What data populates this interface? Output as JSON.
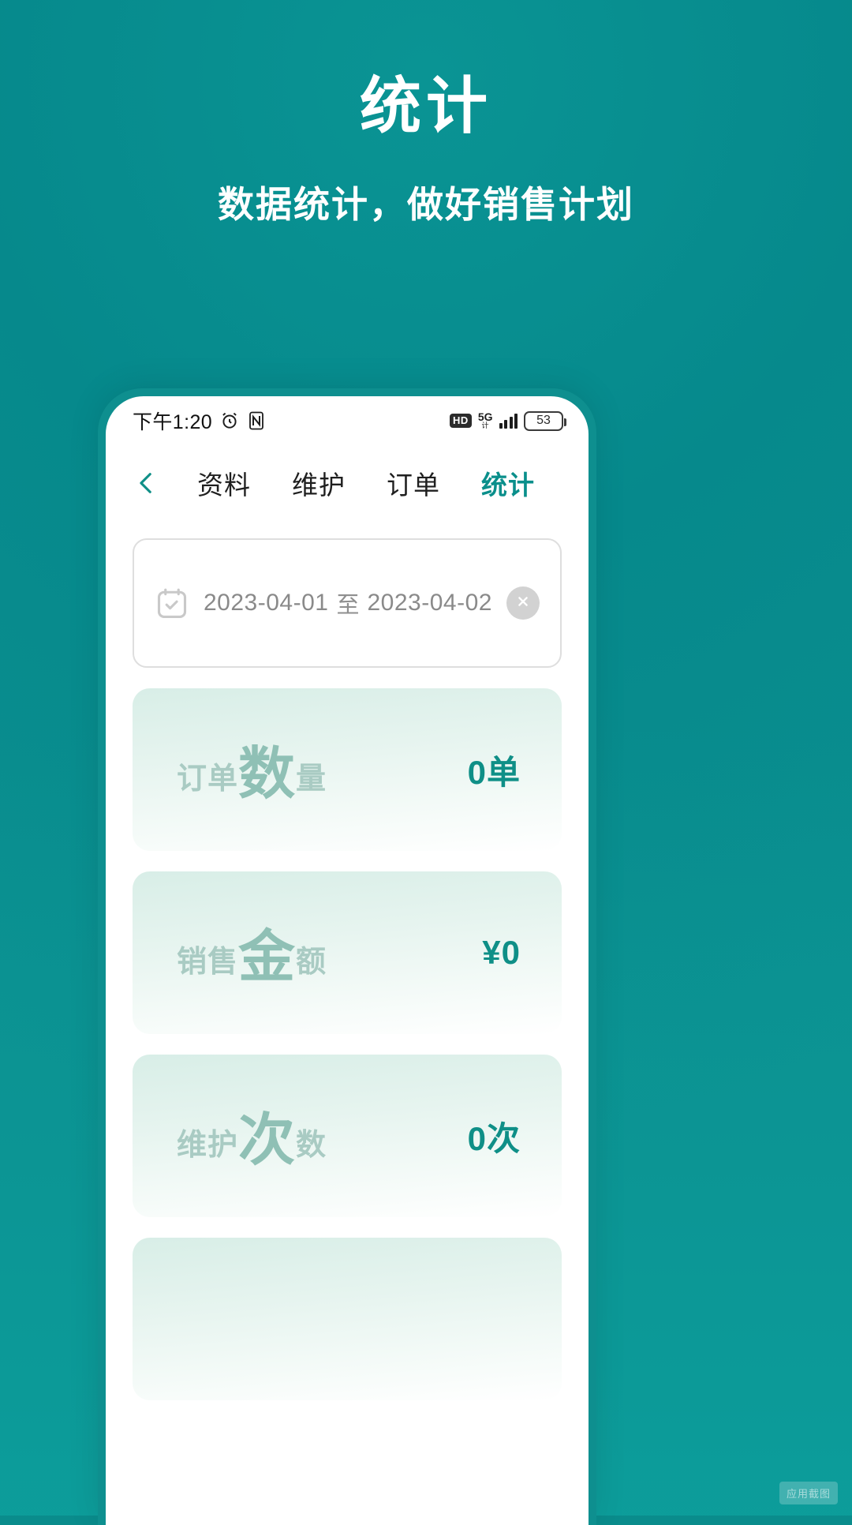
{
  "promo": {
    "title": "统计",
    "subtitle": "数据统计，做好销售计划",
    "bg_color": "#088C8C",
    "title_color": "#FFFFFF"
  },
  "phone": {
    "status_bar": {
      "time": "下午1:20",
      "alarm_icon": "alarm-clock-icon",
      "nfc_icon": "nfc-icon",
      "hd_badge": "HD",
      "network_label": "5G",
      "network_sub": "计",
      "signal_icon": "signal-bars-icon",
      "battery_level": "53"
    },
    "nav": {
      "back_icon": "chevron-left-icon",
      "tabs": [
        {
          "label": "资料",
          "active": false
        },
        {
          "label": "维护",
          "active": false
        },
        {
          "label": "订单",
          "active": false
        },
        {
          "label": "统计",
          "active": true
        }
      ],
      "active_color": "#0A8F8B"
    },
    "date_range": {
      "calendar_icon": "calendar-check-icon",
      "start_date": "2023-04-01",
      "separator": "至",
      "end_date": "2023-04-02",
      "clear_icon": "close-circle-icon"
    },
    "stats": [
      {
        "label_pre": "订单",
        "label_big": "数",
        "label_post": "量",
        "value": "0单"
      },
      {
        "label_pre": "销售",
        "label_big": "金",
        "label_post": "额",
        "value": "¥0"
      },
      {
        "label_pre": "维护",
        "label_big": "次",
        "label_post": "数",
        "value": "0次"
      },
      {
        "label_pre": "",
        "label_big": "",
        "label_post": "",
        "value": ""
      }
    ]
  },
  "watermark": "应用截图"
}
